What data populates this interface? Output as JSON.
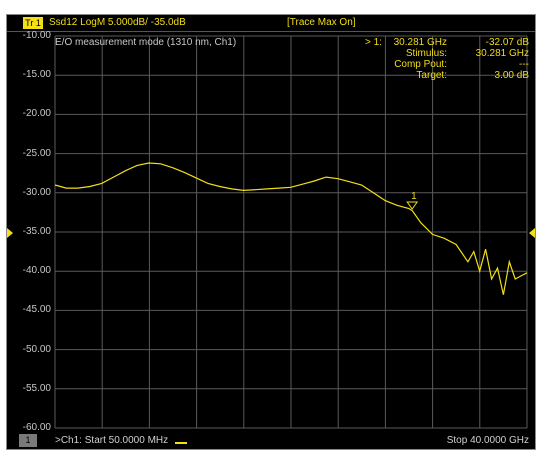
{
  "header": {
    "trace_badge": "Tr 1",
    "trace_info": "Ssd12 LogM 5.000dB/ -35.0dB",
    "trace_max": "[Trace Max On]"
  },
  "mode_text": "E/O measurement mode  (1310 nm, Ch1)",
  "marker_readout": {
    "marker_id": "> 1:",
    "rows": [
      {
        "label": "30.281 GHz",
        "value": "-32.07 dB"
      },
      {
        "label": "Stimulus:",
        "value": "30.281 GHz"
      },
      {
        "label": "Comp Pout:",
        "value": "---"
      },
      {
        "label": "Target:",
        "value": "3.00 dB"
      }
    ]
  },
  "footer": {
    "ch_badge": "1",
    "start": ">Ch1: Start  50.0000 MHz",
    "stop": "Stop  40.0000 GHz"
  },
  "colors": {
    "trace": "#f2df16",
    "grid": "#5a5a5a",
    "background": "#000000"
  },
  "chart_data": {
    "type": "line",
    "title": "",
    "xlabel": "",
    "ylabel": "",
    "xlim": [
      0.05,
      40.0
    ],
    "ylim": [
      -60,
      -10
    ],
    "yticks": [
      "-10.00",
      "-15.00",
      "-20.00",
      "-25.00",
      "-30.00",
      "-35.00",
      "-40.00",
      "-45.00",
      "-50.00",
      "-55.00",
      "-60.00"
    ],
    "reference_level": -35.0,
    "x_divisions": 10,
    "grid": true,
    "marker": {
      "id": "1",
      "x": 30.281,
      "y": -32.07
    },
    "series": [
      {
        "x": [
          0.05,
          1,
          2,
          3,
          4,
          5,
          6,
          7,
          8,
          9,
          10,
          11,
          12,
          13,
          14,
          15,
          16,
          17,
          18,
          19,
          20,
          21,
          22,
          23,
          24,
          25,
          26,
          27,
          28,
          29,
          30,
          30.3,
          31,
          32,
          33,
          34,
          35,
          35.5,
          36,
          36.5,
          37,
          37.5,
          38,
          38.5,
          39,
          39.5,
          40
        ],
        "y": [
          -29.0,
          -29.4,
          -29.4,
          -29.2,
          -28.8,
          -28.0,
          -27.2,
          -26.5,
          -26.2,
          -26.3,
          -26.8,
          -27.4,
          -28.1,
          -28.8,
          -29.2,
          -29.5,
          -29.7,
          -29.6,
          -29.5,
          -29.4,
          -29.3,
          -28.9,
          -28.5,
          -28.0,
          -28.2,
          -28.6,
          -29.0,
          -30.0,
          -31.0,
          -31.6,
          -32.0,
          -32.3,
          -33.8,
          -35.3,
          -35.8,
          -36.6,
          -38.8,
          -37.5,
          -40.0,
          -37.2,
          -41.0,
          -39.6,
          -43.0,
          -38.8,
          -41.0,
          -40.6,
          -40.2
        ]
      }
    ]
  }
}
